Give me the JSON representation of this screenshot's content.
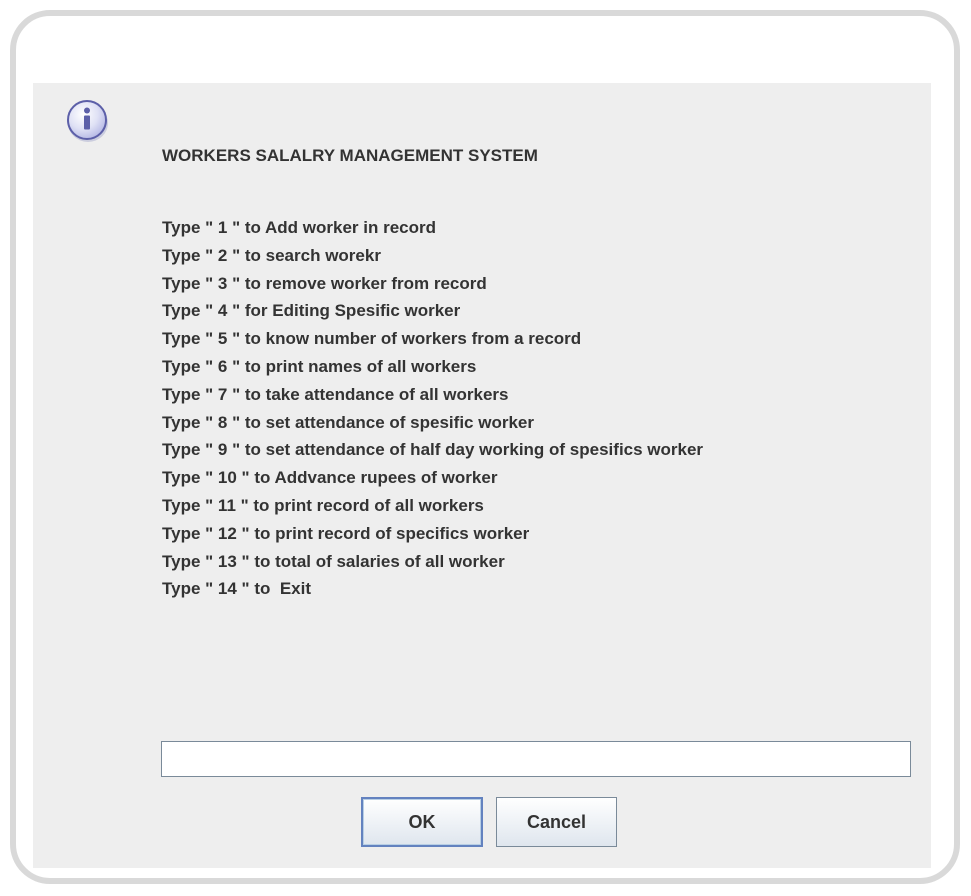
{
  "dialog": {
    "icon": "info-icon",
    "title": "WORKERS SALALRY MANAGEMENT SYSTEM",
    "options": [
      "Type \" 1 \" to Add worker in record",
      "Type \" 2 \" to search worekr",
      "Type \" 3 \" to remove worker from record",
      "Type \" 4 \" for Editing Spesific worker",
      "Type \" 5 \" to know number of workers from a record",
      "Type \" 6 \" to print names of all workers",
      "Type \" 7 \" to take attendance of all workers",
      "Type \" 8 \" to set attendance of spesific worker",
      "Type \" 9 \" to set attendance of half day working of spesifics worker",
      "Type \" 10 \" to Addvance rupees of worker",
      "Type \" 11 \" to print record of all workers",
      "Type \" 12 \" to print record of specifics worker",
      "Type \" 13 \" to total of salaries of all worker",
      "Type \" 14 \" to  Exit"
    ],
    "input": {
      "value": "",
      "placeholder": ""
    },
    "buttons": {
      "ok": "OK",
      "cancel": "Cancel"
    }
  },
  "colors": {
    "dialog_background": "#eeeeee",
    "frame_border": "#d9d9d9",
    "text": "#333333",
    "focus_border": "#6382bf"
  }
}
